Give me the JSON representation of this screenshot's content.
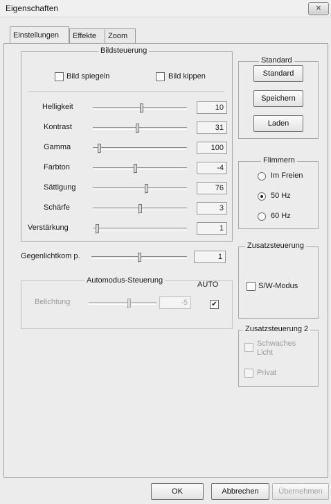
{
  "window": {
    "title": "Eigenschaften",
    "close_label": "✕"
  },
  "tabs": [
    {
      "label": "Einstellungen",
      "active": true
    },
    {
      "label": "Effekte",
      "active": false
    },
    {
      "label": "Zoom",
      "active": false
    }
  ],
  "bildsteuerung": {
    "title": "Bildsteuerung",
    "mirror_label": "Bild spiegeln",
    "flip_label": "Bild kippen",
    "sliders": [
      {
        "label": "Helligkeit",
        "value": "10",
        "level": 0.52
      },
      {
        "label": "Kontrast",
        "value": "31",
        "level": 0.47
      },
      {
        "label": "Gamma",
        "value": "100",
        "level": 0.05
      },
      {
        "label": "Farbton",
        "value": "-4",
        "level": 0.45
      },
      {
        "label": "Sättigung",
        "value": "76",
        "level": 0.57
      },
      {
        "label": "Schärfe",
        "value": "3",
        "level": 0.5
      },
      {
        "label": "Verstärkung",
        "value": "1",
        "level": 0.03
      }
    ]
  },
  "backlight": {
    "label": "Gegenlichtkom p.",
    "value": "1",
    "level": 0.5
  },
  "automodus": {
    "title": "Automodus-Steuerung",
    "auto_label": "AUTO",
    "auto_checked": true,
    "exposure_label": "Belichtung",
    "exposure_value": "-5",
    "exposure_level": 0.6
  },
  "standard": {
    "title": "Standard",
    "standard_button": "Standard",
    "save_button": "Speichern",
    "load_button": "Laden"
  },
  "flimmern": {
    "title": "Flimmern",
    "options": [
      {
        "label": "Im Freien",
        "selected": false
      },
      {
        "label": "50 Hz",
        "selected": true
      },
      {
        "label": "60 Hz",
        "selected": false
      }
    ]
  },
  "zusatz1": {
    "title": "Zusatzsteuerung",
    "sw_label": "S/W-Modus"
  },
  "zusatz2": {
    "title": "Zusatzsteuerung 2",
    "low_light_label": "Schwaches Licht",
    "private_label": "Privat"
  },
  "footer": {
    "ok": "OK",
    "cancel": "Abbrechen",
    "apply": "Übernehmen"
  }
}
